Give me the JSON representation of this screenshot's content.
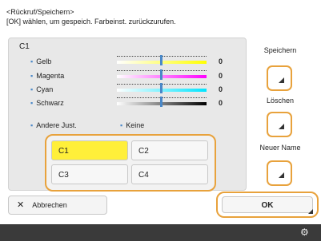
{
  "header": {
    "line1": "<Rückruf/Speichern>",
    "line2": "[OK] wählen, um gespeich. Farbeinst. zurückzurufen."
  },
  "panel": {
    "title": "C1",
    "colors": [
      {
        "label": "Gelb",
        "value": "0",
        "bar_color": "#ffff00"
      },
      {
        "label": "Magenta",
        "value": "0",
        "bar_color": "#ff00ff"
      },
      {
        "label": "Cyan",
        "value": "0",
        "bar_color": "#00e5ff"
      },
      {
        "label": "Schwarz",
        "value": "0",
        "bar_color": "#000000"
      }
    ],
    "other": {
      "label": "Andere Just.",
      "value": "Keine"
    }
  },
  "slots": [
    "C1",
    "C2",
    "C3",
    "C4"
  ],
  "selected_slot": "C1",
  "side": {
    "save_label": "Speichern",
    "delete_label": "Löschen",
    "rename_label": "Neuer Name"
  },
  "footer_buttons": {
    "cancel_label": "Abbrechen",
    "ok_label": "OK"
  },
  "icons": {
    "cancel": "close-icon",
    "side_buttons": "corner-triangle-icon",
    "footer": "settings-icon"
  }
}
